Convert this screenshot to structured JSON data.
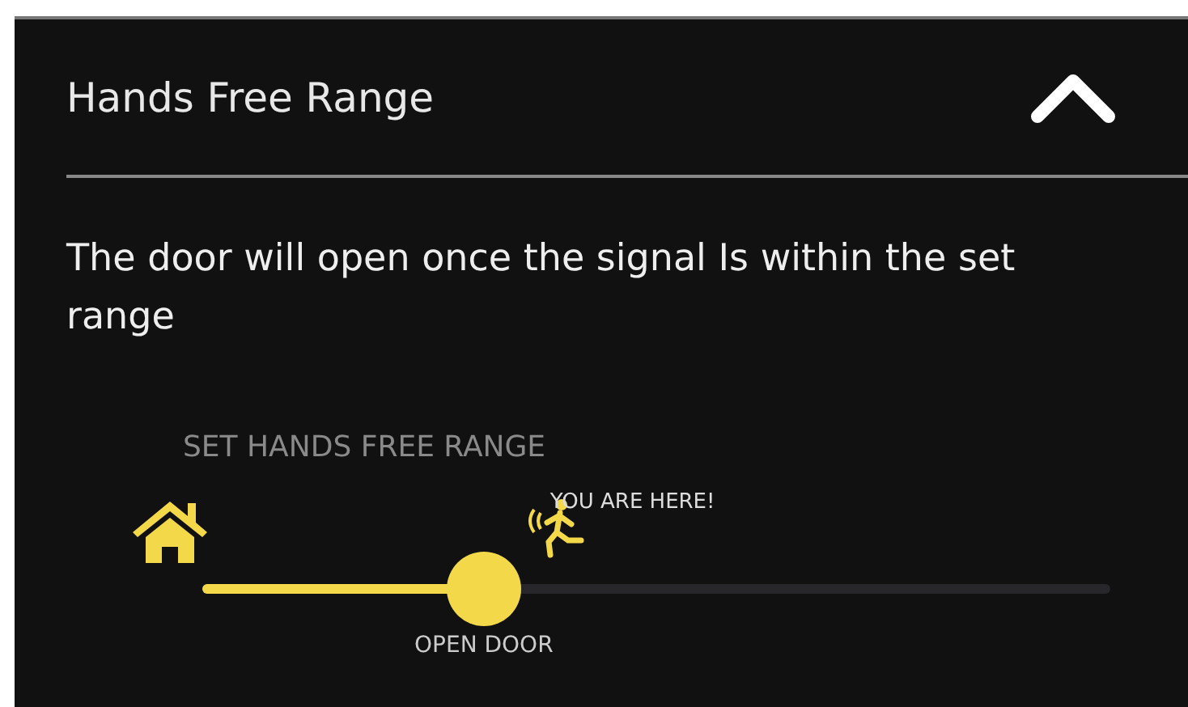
{
  "section": {
    "title": "Hands Free Range",
    "expanded": true
  },
  "description": "The door will open once the signal Is within the set range",
  "range": {
    "label": "SET HANDS FREE RANGE",
    "level": 0.31,
    "position_label": "YOU ARE HERE!",
    "thumb_label": "OPEN DOOR"
  }
}
